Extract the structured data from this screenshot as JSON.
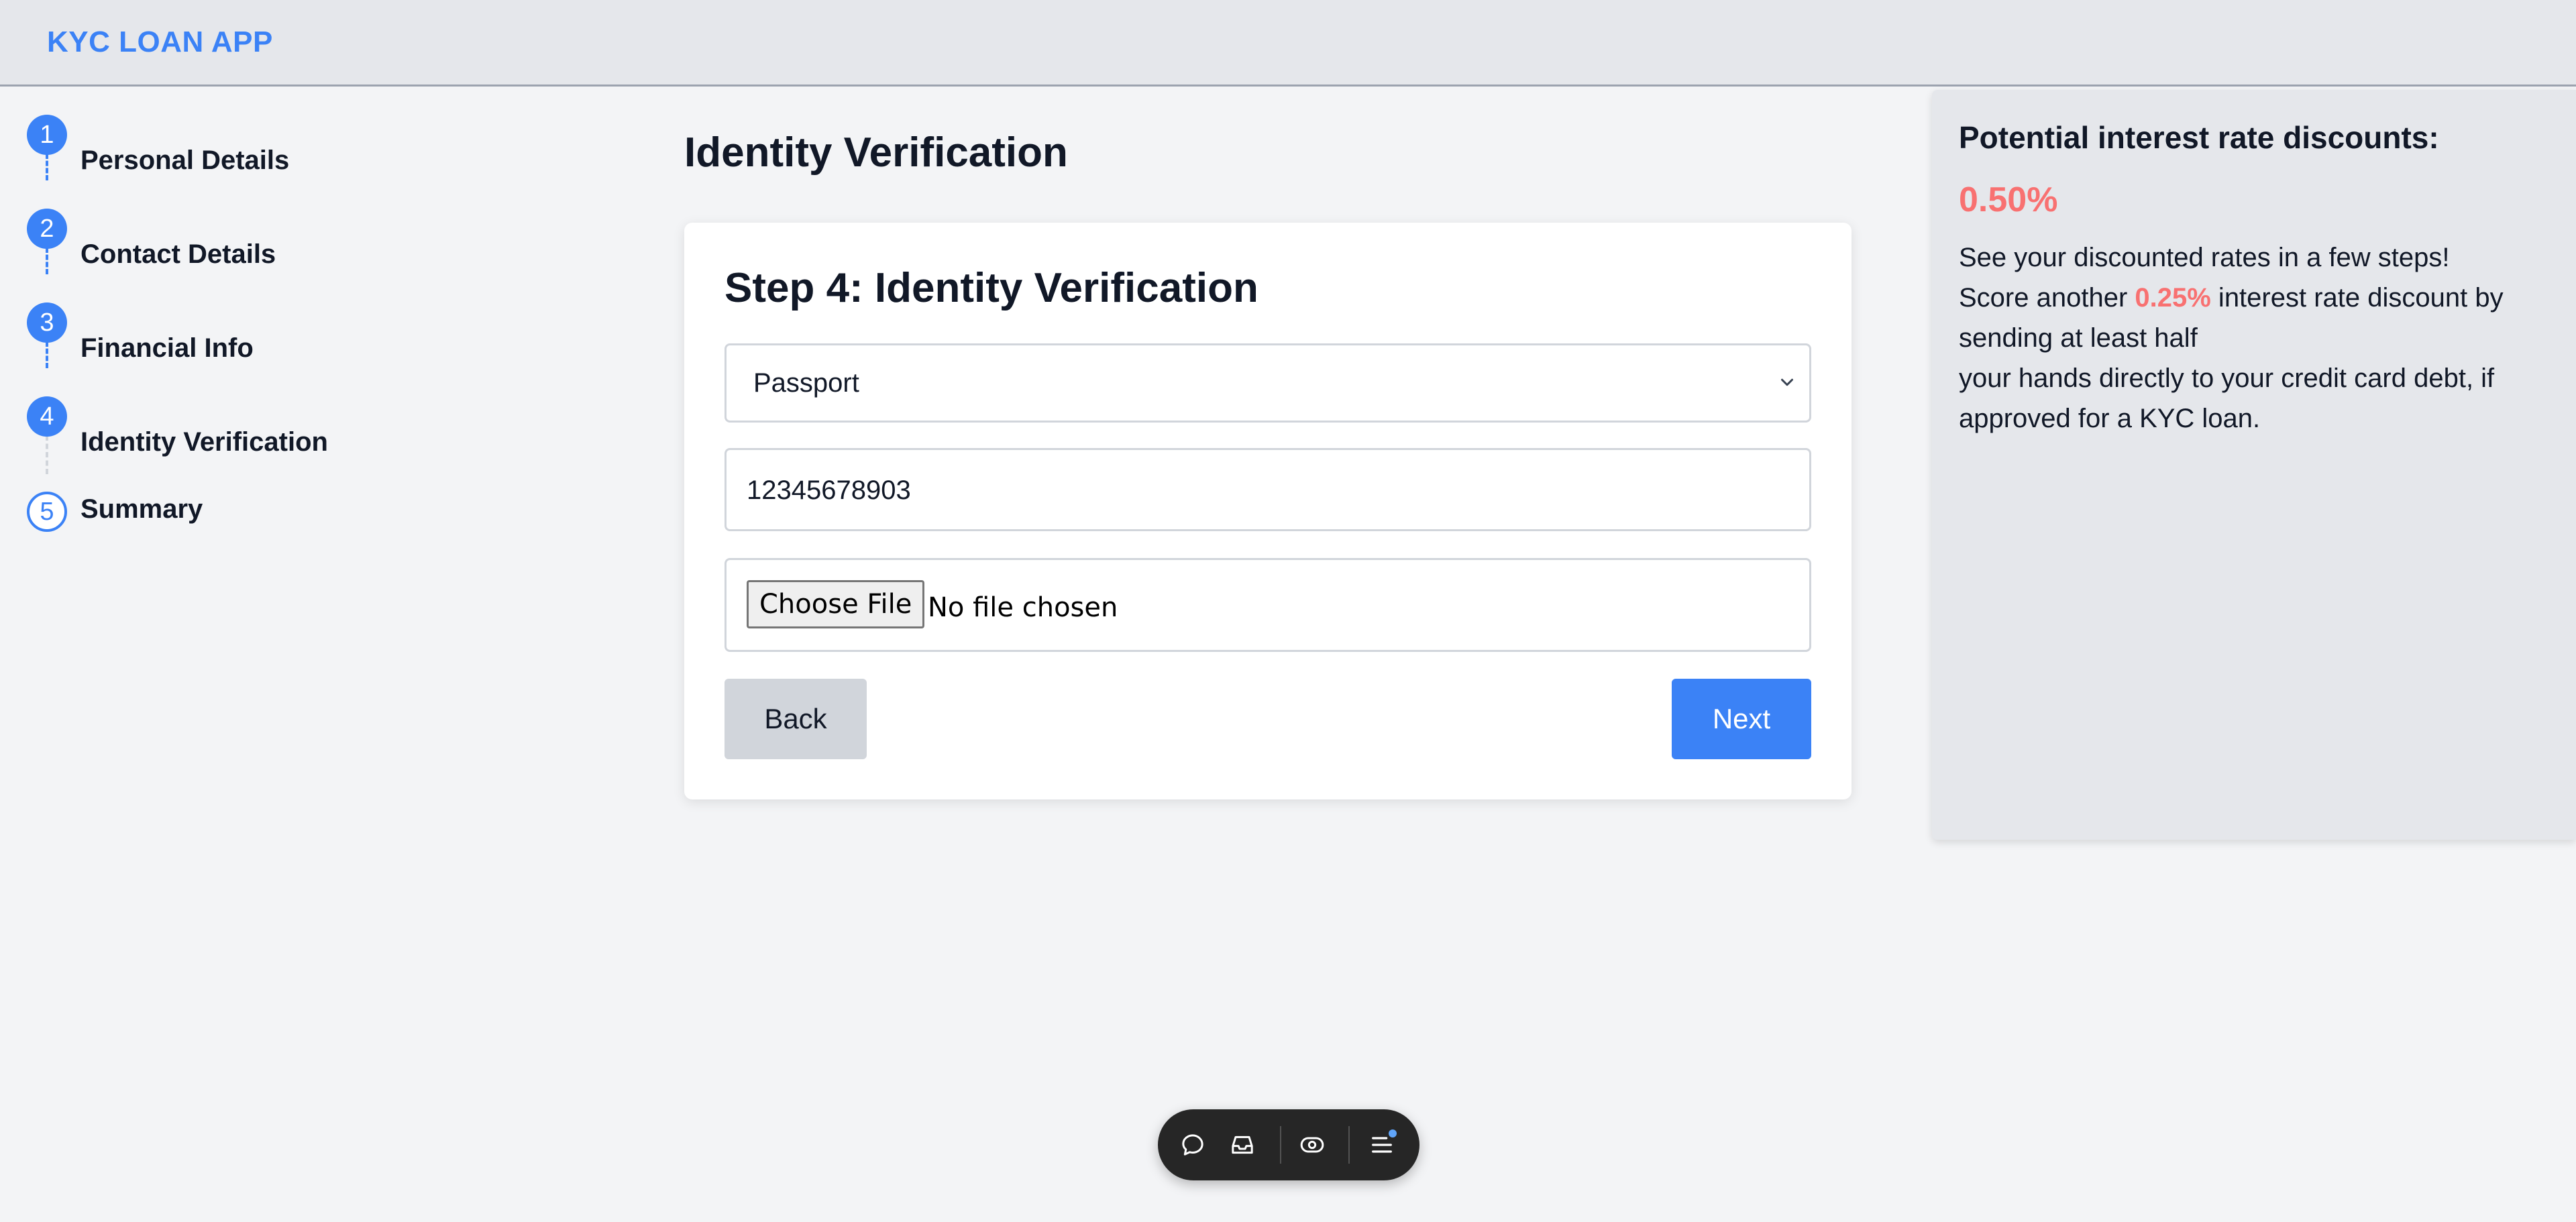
{
  "app": {
    "brand": "KYC LOAN APP"
  },
  "stepper": {
    "steps": [
      {
        "number": "1",
        "label": "Personal Details",
        "state": "complete"
      },
      {
        "number": "2",
        "label": "Contact Details",
        "state": "complete"
      },
      {
        "number": "3",
        "label": "Financial Info",
        "state": "complete"
      },
      {
        "number": "4",
        "label": "Identity Verification",
        "state": "current"
      },
      {
        "number": "5",
        "label": "Summary",
        "state": "upcoming"
      }
    ]
  },
  "main": {
    "title": "Identity Verification",
    "card": {
      "title": "Step 4: Identity Verification",
      "id_type_selected": "Passport",
      "id_number_value": "12345678903",
      "file_button_label": "Choose File",
      "file_status": "No file chosen",
      "back_label": "Back",
      "next_label": "Next"
    }
  },
  "promo": {
    "title": "Potential interest rate discounts:",
    "rate": "0.50%",
    "line1": "See your discounted rates in a few steps!",
    "line2_prefix": "Score another ",
    "line2_highlight": "0.25%",
    "line2_suffix": " interest rate discount by sending at least half",
    "line3": "your hands directly to your credit card debt, if approved for a KYC loan."
  },
  "toolbar": {
    "icons": [
      "chat-icon",
      "inbox-icon",
      "eye-icon",
      "menu-icon"
    ]
  },
  "colors": {
    "accent": "#3b82f6",
    "highlight": "#f87171",
    "background": "#f3f4f6",
    "panel": "#e5e7eb"
  }
}
